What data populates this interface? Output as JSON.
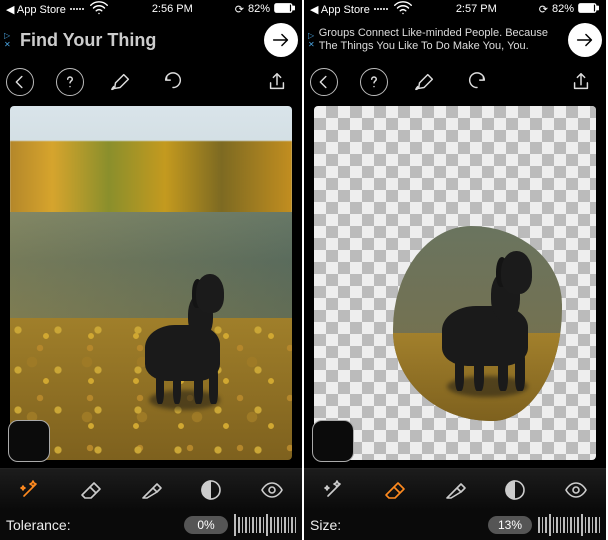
{
  "left": {
    "statusbar": {
      "back_app": "App Store",
      "time": "2:56 PM",
      "battery": "82%"
    },
    "ad": {
      "text": "Find Your Thing"
    },
    "slider": {
      "label": "Tolerance:",
      "value": "0%"
    }
  },
  "right": {
    "statusbar": {
      "back_app": "App Store",
      "time": "2:57 PM",
      "battery": "82%"
    },
    "ad": {
      "text": "Groups Connect Like-minded People. Because The Things You Like To Do Make You, You."
    },
    "slider": {
      "label": "Size:",
      "value": "13%"
    }
  },
  "subject": "black dog standing in shallow water with autumn leaves"
}
